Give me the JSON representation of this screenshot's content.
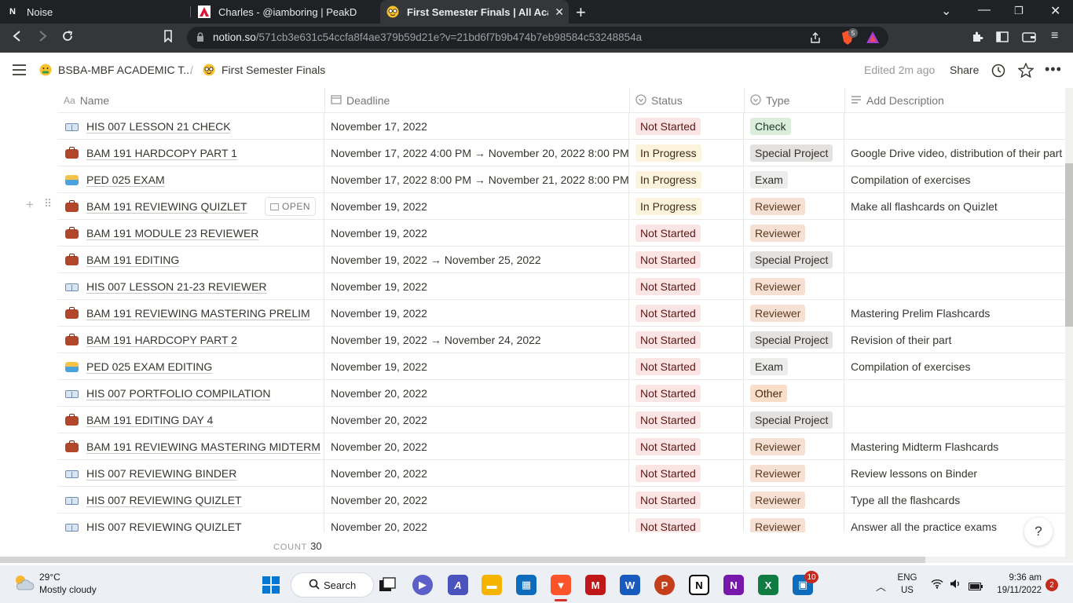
{
  "browser": {
    "tabs": [
      {
        "title": "Noise",
        "favicon": "N"
      },
      {
        "title": "Charles - @iamboring | PeakD",
        "favicon": "peakd"
      },
      {
        "title": "First Semester Finals | All Academ",
        "favicon": "nerd-face",
        "active": true
      }
    ],
    "url_host": "notion.so",
    "url_path": "/571cb3e631c54ccfa8f4ae379b59d21e?v=21bd6f7b9b474b7eb98584c53248854a",
    "brave_badge": "5"
  },
  "notion": {
    "breadcrumb": [
      {
        "icon": "money-mouth",
        "label": "BSBA-MBF ACADEMIC T..."
      },
      {
        "icon": "nerd-face",
        "label": "First Semester Finals"
      }
    ],
    "breadcrumb_sep": "/",
    "edited": "Edited 2m ago",
    "share": "Share"
  },
  "table": {
    "columns": [
      {
        "icon": "Aa",
        "label": "Name"
      },
      {
        "icon": "calendar",
        "label": "Deadline"
      },
      {
        "icon": "status",
        "label": "Status"
      },
      {
        "icon": "select",
        "label": "Type"
      },
      {
        "icon": "text",
        "label": "Add Description"
      }
    ],
    "rows": [
      {
        "icon": "book",
        "name": "HIS 007 LESSON 21 CHECK",
        "deadline": "November 17, 2022",
        "status": "Not Started",
        "type": "Check",
        "description": ""
      },
      {
        "icon": "briefcase",
        "name": "BAM 191 HARDCOPY PART 1",
        "deadline": "November 17, 2022 4:00 PM → November 20, 2022 8:00 PM",
        "status": "In Progress",
        "type": "Special Project",
        "description": "Google Drive video, distribution of their part"
      },
      {
        "icon": "swimmer",
        "name": "PED 025 EXAM",
        "deadline": "November 17, 2022 8:00 PM → November 21, 2022 8:00 PM",
        "status": "In Progress",
        "type": "Exam",
        "description": "Compilation of exercises"
      },
      {
        "icon": "briefcase",
        "name": "BAM 191 REVIEWING QUIZLET",
        "deadline": "November 19, 2022",
        "status": "In Progress",
        "type": "Reviewer",
        "description": "Make all flashcards on Quizlet",
        "hover": true
      },
      {
        "icon": "briefcase",
        "name": "BAM 191 MODULE 23 REVIEWER",
        "deadline": "November 19, 2022",
        "status": "Not Started",
        "type": "Reviewer",
        "description": ""
      },
      {
        "icon": "briefcase",
        "name": "BAM 191 EDITING",
        "deadline": "November 19, 2022 → November 25, 2022",
        "status": "Not Started",
        "type": "Special Project",
        "description": ""
      },
      {
        "icon": "book",
        "name": "HIS 007 LESSON 21-23 REVIEWER",
        "deadline": "November 19, 2022",
        "status": "Not Started",
        "type": "Reviewer",
        "description": ""
      },
      {
        "icon": "briefcase",
        "name": "BAM 191 REVIEWING MASTERING PRELIM",
        "deadline": "November 19, 2022",
        "status": "Not Started",
        "type": "Reviewer",
        "description": "Mastering Prelim Flashcards"
      },
      {
        "icon": "briefcase",
        "name": "BAM 191 HARDCOPY PART 2",
        "deadline": "November 19, 2022 → November 24, 2022",
        "status": "Not Started",
        "type": "Special Project",
        "description": "Revision of their part"
      },
      {
        "icon": "swimmer",
        "name": "PED 025 EXAM EDITING",
        "deadline": "November 19, 2022",
        "status": "Not Started",
        "type": "Exam",
        "description": "Compilation of exercises"
      },
      {
        "icon": "book",
        "name": "HIS 007 PORTFOLIO COMPILATION",
        "deadline": "November 20, 2022",
        "status": "Not Started",
        "type": "Other",
        "description": ""
      },
      {
        "icon": "briefcase",
        "name": "BAM 191 EDITING DAY 4",
        "deadline": "November 20, 2022",
        "status": "Not Started",
        "type": "Special Project",
        "description": ""
      },
      {
        "icon": "briefcase",
        "name": "BAM 191 REVIEWING MASTERING MIDTERM",
        "deadline": "November 20, 2022",
        "status": "Not Started",
        "type": "Reviewer",
        "description": "Mastering Midterm Flashcards"
      },
      {
        "icon": "book",
        "name": "HIS 007 REVIEWING BINDER",
        "deadline": "November 20, 2022",
        "status": "Not Started",
        "type": "Reviewer",
        "description": "Review lessons on Binder"
      },
      {
        "icon": "book",
        "name": "HIS 007 REVIEWING QUIZLET",
        "deadline": "November 20, 2022",
        "status": "Not Started",
        "type": "Reviewer",
        "description": "Type all the flashcards"
      },
      {
        "icon": "book",
        "name": "HIS 007 REVIEWING QUIZLET",
        "deadline": "November 20, 2022",
        "status": "Not Started",
        "type": "Reviewer",
        "description": "Answer all the practice exams"
      }
    ],
    "open_label": "OPEN",
    "count_label": "COUNT",
    "count_value": "30",
    "help": "?"
  },
  "taskbar": {
    "weather_temp": "29°C",
    "weather_desc": "Mostly cloudy",
    "search_label": "Search",
    "store_badge": "10",
    "lang_top": "ENG",
    "lang_bottom": "US",
    "time": "9:36 am",
    "date": "19/11/2022",
    "notif_count": "2"
  },
  "colors": {
    "status_not_started": "#fbe4e4",
    "status_in_progress": "#fbf3db",
    "type_check": "#dbeddb",
    "type_reviewer": "#f5e0d3",
    "type_special": "#e3e2e0"
  }
}
